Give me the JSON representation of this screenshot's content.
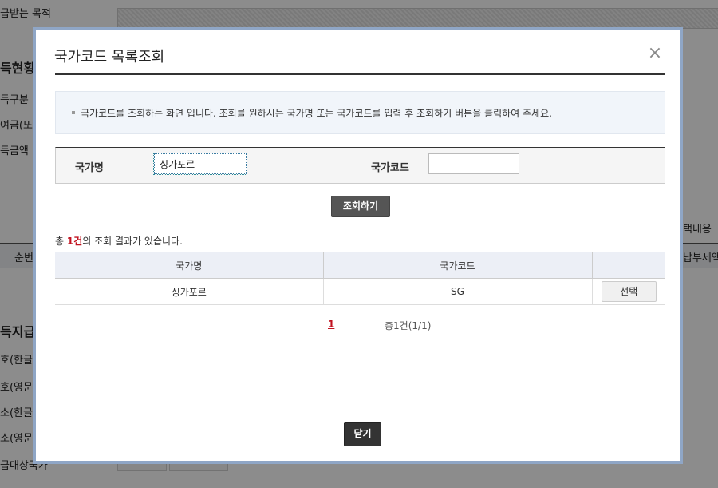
{
  "background": {
    "labels": [
      "급받는 목적",
      "득현황",
      "득구분",
      "여금(또",
      "득금액",
      "순번",
      "득지급",
      "호(한글",
      "호(영문",
      "소(한글",
      "소(영문",
      "급대상국가"
    ],
    "right_labels": [
      "택내용",
      "납부세액"
    ]
  },
  "modal": {
    "title": "국가코드 목록조회",
    "info_text": "국가코드를 조회하는 화면 입니다. 조회를 원하시는 국가명 또는 국가코드를 입력 후 조회하기 버튼을 클릭하여 주세요.",
    "search": {
      "country_name_label": "국가명",
      "country_name_value": "싱가포르",
      "country_code_label": "국가코드",
      "country_code_value": ""
    },
    "search_button": "조회하기",
    "result_summary": {
      "prefix": "총 ",
      "count": "1건",
      "suffix": "의 조회 결과가 있습니다."
    },
    "table": {
      "headers": [
        "국가명",
        "국가코드",
        ""
      ],
      "rows": [
        {
          "name": "싱가포르",
          "code": "SG",
          "action": "선택"
        }
      ]
    },
    "pager": {
      "current_page": "1",
      "total_text": "총1건(1/1)"
    },
    "close_button": "닫기"
  },
  "colors": {
    "accent_red": "#c1121f",
    "frame_blue": "#8fa6c6"
  }
}
